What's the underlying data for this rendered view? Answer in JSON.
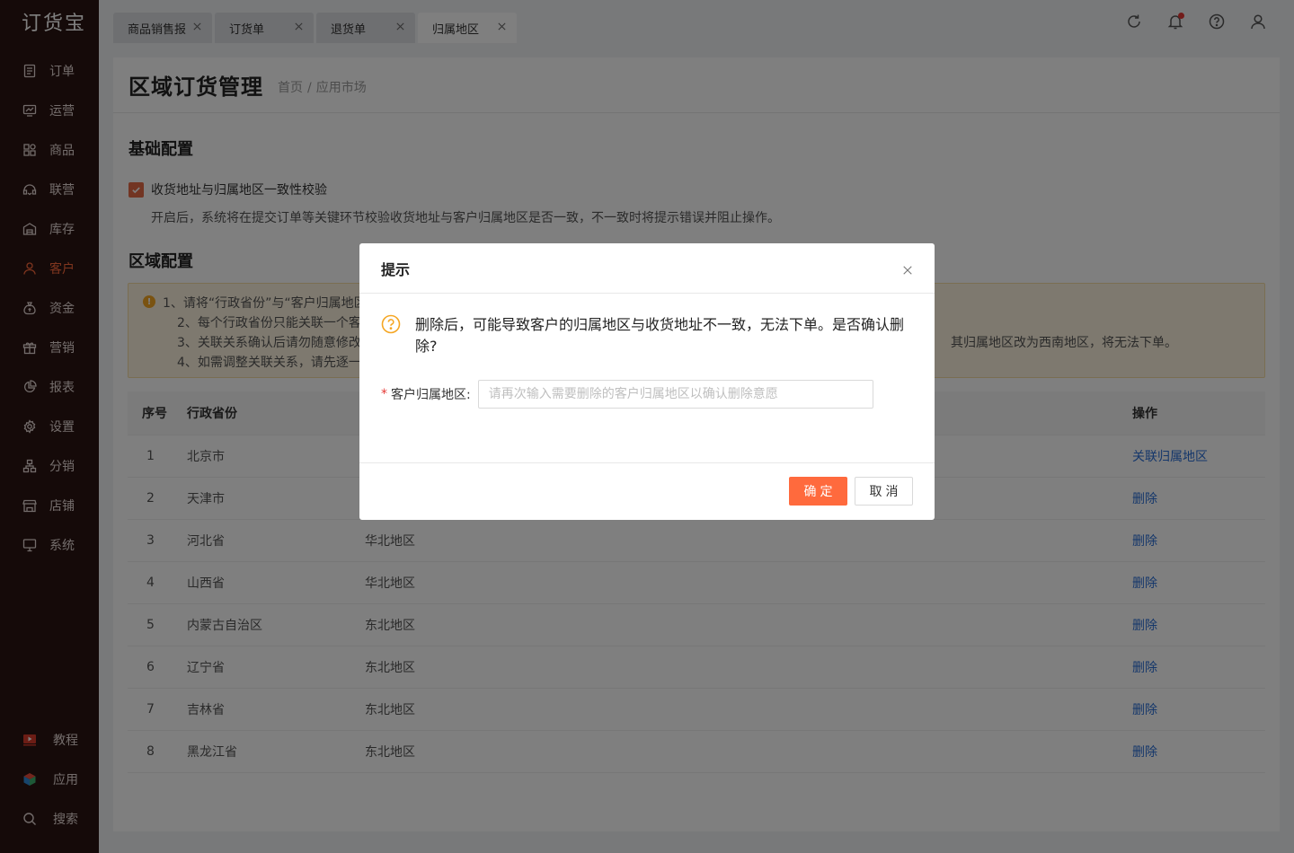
{
  "sidebar": {
    "logo": "订货宝",
    "items": [
      {
        "label": "订单",
        "icon": "order-icon"
      },
      {
        "label": "运营",
        "icon": "operation-icon"
      },
      {
        "label": "商品",
        "icon": "goods-icon"
      },
      {
        "label": "联营",
        "icon": "joint-icon"
      },
      {
        "label": "库存",
        "icon": "warehouse-icon"
      },
      {
        "label": "客户",
        "icon": "customer-icon"
      },
      {
        "label": "资金",
        "icon": "money-icon"
      },
      {
        "label": "营销",
        "icon": "gift-icon"
      },
      {
        "label": "报表",
        "icon": "report-icon"
      },
      {
        "label": "设置",
        "icon": "gear-icon"
      },
      {
        "label": "分销",
        "icon": "distribution-icon"
      },
      {
        "label": "店铺",
        "icon": "store-icon"
      },
      {
        "label": "系统",
        "icon": "monitor-icon"
      }
    ],
    "bottom_items": [
      {
        "label": "教程",
        "icon": "video-icon"
      },
      {
        "label": "应用",
        "icon": "cube-icon"
      },
      {
        "label": "搜索",
        "icon": "search-icon"
      }
    ],
    "active_label": "客户",
    "accent_color": "#ff6a3d",
    "background_color": "#2b1512"
  },
  "tabs": [
    "商品销售报",
    "订货单",
    "退货单",
    "归属地区"
  ],
  "active_tab": "归属地区",
  "top_icons": [
    "refresh-icon",
    "bell-icon",
    "help-icon",
    "user-icon"
  ],
  "page": {
    "title": "区域订货管理",
    "breadcrumb": [
      "首页",
      "应用市场"
    ],
    "breadcrumb_sep": "/"
  },
  "basic_config": {
    "title": "基础配置",
    "checkbox_label": "收货地址与归属地区一致性校验",
    "checked": true,
    "description": "开启后，系统将在提交订单等关键环节校验收货地址与客户归属地区是否一致，不一致时将提示错误并阻止操作。"
  },
  "region_config": {
    "title": "区域配置",
    "alert_lines": [
      "1、请将“行政省份”与“客户归属地区",
      "2、每个行政省份只能关联一个客户",
      "3、关联关系确认后请勿随意修改,",
      "4、如需调整关联关系，请先逐一修"
    ],
    "alert_tail": "其归属地区改为西南地区，将无法下单。"
  },
  "table": {
    "headers": [
      "序号",
      "行政省份",
      "",
      "操作"
    ],
    "rows": [
      {
        "no": "1",
        "province": "北京市",
        "area": "",
        "action": "关联归属地区"
      },
      {
        "no": "2",
        "province": "天津市",
        "area": "",
        "action": "删除"
      },
      {
        "no": "3",
        "province": "河北省",
        "area": "华北地区",
        "action": "删除"
      },
      {
        "no": "4",
        "province": "山西省",
        "area": "华北地区",
        "action": "删除"
      },
      {
        "no": "5",
        "province": "内蒙古自治区",
        "area": "东北地区",
        "action": "删除"
      },
      {
        "no": "6",
        "province": "辽宁省",
        "area": "东北地区",
        "action": "删除"
      },
      {
        "no": "7",
        "province": "吉林省",
        "area": "东北地区",
        "action": "删除"
      },
      {
        "no": "8",
        "province": "黑龙江省",
        "area": "东北地区",
        "action": "删除"
      }
    ]
  },
  "dialog": {
    "title": "提示",
    "message": "删除后，可能导致客户的归属地区与收货地址不一致，无法下单。是否确认删除?",
    "field_label": "客户归属地区:",
    "field_required": "*",
    "field_placeholder": "请再次输入需要删除的客户归属地区以确认删除意愿",
    "field_value": "",
    "ok_label": "确定",
    "cancel_label": "取消"
  }
}
